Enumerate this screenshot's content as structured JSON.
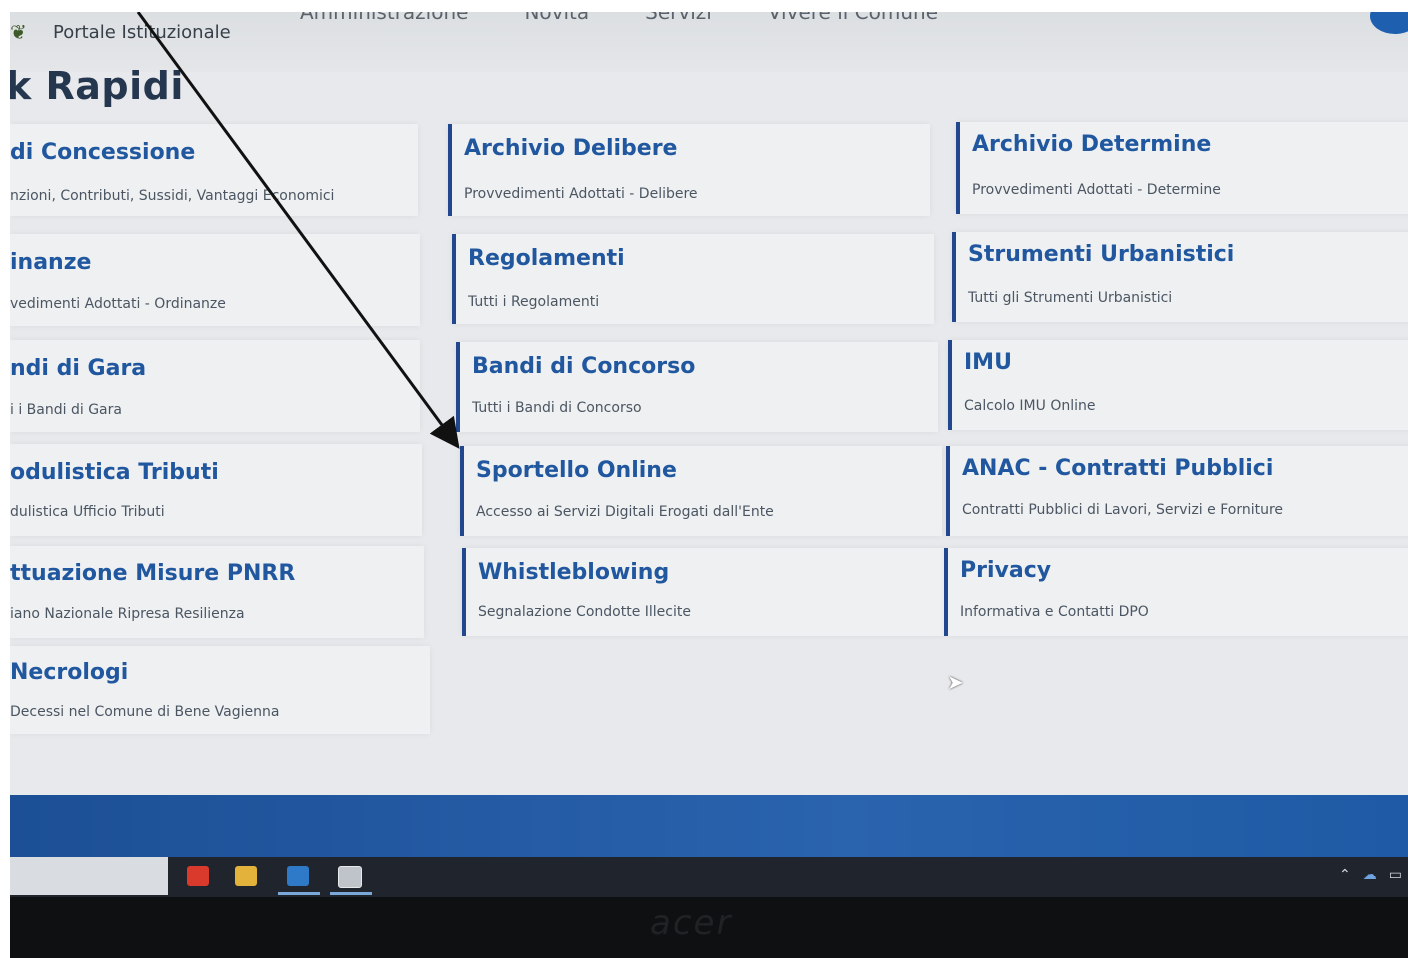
{
  "header": {
    "portal_title": "Portale Istituzionale",
    "nav_items": [
      "Amministrazione",
      "Novità",
      "Servizi",
      "Vivere il Comune"
    ]
  },
  "section_title": "k Rapidi",
  "links": {
    "col1": [
      {
        "title": "di Concessione",
        "subtitle": "nzioni, Contributi, Sussidi, Vantaggi Economici"
      },
      {
        "title": "inanze",
        "subtitle": "vedimenti Adottati - Ordinanze"
      },
      {
        "title": "ndi di Gara",
        "subtitle": "i i Bandi di Gara"
      },
      {
        "title": "odulistica Tributi",
        "subtitle": "dulistica Ufficio Tributi"
      },
      {
        "title": "ttuazione Misure PNRR",
        "subtitle": "iano Nazionale Ripresa Resilienza"
      },
      {
        "title": "Necrologi",
        "subtitle": "Decessi nel Comune di Bene Vagienna"
      }
    ],
    "col2": [
      {
        "title": "Archivio Delibere",
        "subtitle": "Provvedimenti Adottati - Delibere"
      },
      {
        "title": "Regolamenti",
        "subtitle": "Tutti i Regolamenti"
      },
      {
        "title": "Bandi di Concorso",
        "subtitle": "Tutti i Bandi di Concorso"
      },
      {
        "title": "Sportello Online",
        "subtitle": "Accesso ai Servizi Digitali Erogati dall'Ente"
      },
      {
        "title": "Whistleblowing",
        "subtitle": "Segnalazione Condotte Illecite"
      }
    ],
    "col3": [
      {
        "title": "Archivio Determine",
        "subtitle": "Provvedimenti Adottati - Determine"
      },
      {
        "title": "Strumenti Urbanistici",
        "subtitle": "Tutti gli Strumenti Urbanistici"
      },
      {
        "title": "IMU",
        "subtitle": "Calcolo IMU Online"
      },
      {
        "title": "ANAC - Contratti Pubblici",
        "subtitle": "Contratti Pubblici di Lavori, Servizi e Forniture"
      },
      {
        "title": "Privacy",
        "subtitle": "Informativa e Contatti DPO"
      }
    ]
  },
  "device_brand": "acer",
  "colors": {
    "accent": "#20579f",
    "card_border": "#21478f",
    "footer_band": "#2a63ae",
    "taskbar": "#20252d"
  },
  "icons": {
    "logo": "municipal-crest-icon",
    "taskbar": [
      "chrome-icon",
      "file-explorer-icon",
      "outlook-icon",
      "task-app-icon"
    ],
    "tray": [
      "chevron-up-icon",
      "cloud-icon",
      "network-icon"
    ],
    "annotation": "arrow-annotation"
  }
}
